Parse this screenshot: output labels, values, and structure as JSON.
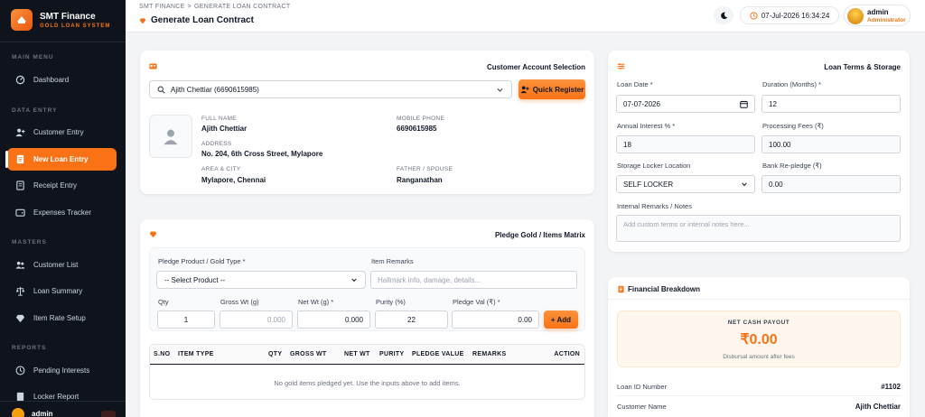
{
  "brand": {
    "title": "SMT Finance",
    "subtitle": "GOLD LOAN SYSTEM"
  },
  "sidebar": {
    "sections": [
      "MAIN MENU",
      "DATA ENTRY",
      "MASTERS",
      "REPORTS"
    ],
    "items": [
      {
        "label": "Dashboard",
        "icon": "dashboard-icon"
      },
      {
        "label": "Customer Entry",
        "icon": "user-plus-icon"
      },
      {
        "label": "New Loan Entry",
        "icon": "document-icon"
      },
      {
        "label": "Receipt Entry",
        "icon": "receipt-icon"
      },
      {
        "label": "Expenses Tracker",
        "icon": "wallet-icon"
      },
      {
        "label": "Customer List",
        "icon": "users-icon"
      },
      {
        "label": "Loan Summary",
        "icon": "scale-icon"
      },
      {
        "label": "Item Rate Setup",
        "icon": "gem-icon"
      },
      {
        "label": "Pending Interests",
        "icon": "clock-icon"
      },
      {
        "label": "Locker Report",
        "icon": "report-icon"
      }
    ],
    "user": "admin"
  },
  "header": {
    "breadcrumb": [
      "SMT FINANCE",
      "GENERATE LOAN CONTRACT"
    ],
    "title": "Generate Loan Contract",
    "datetime": "07-Jul-2026 16:34:24",
    "user_name": "admin",
    "user_role": "Administrator"
  },
  "customer": {
    "heading": "Customer Account Selection",
    "selected": "Ajith Chettiar (6690615985)",
    "quick_register": "Quick Register",
    "full_name_label": "FULL NAME",
    "full_name": "Ajith Chettiar",
    "mobile_label": "MOBILE PHONE",
    "mobile": "6690615985",
    "address_label": "ADDRESS",
    "address": "No. 204, 6th Cross Street, Mylapore",
    "area_label": "AREA & CITY",
    "area": "Mylapore, Chennai",
    "father_label": "FATHER / SPOUSE",
    "father": "Ranganathan"
  },
  "pledge": {
    "heading": "Pledge Gold / Items Matrix",
    "product_label": "Pledge Product / Gold Type *",
    "product_value": "-- Select Product --",
    "remarks_label": "Item Remarks",
    "remarks_placeholder": "Hallmark info, damage, details...",
    "qty_label": "Qty",
    "gross_label": "Gross Wt (g)",
    "net_label": "Net Wt (g) *",
    "purity_label": "Purity (%)",
    "val_label": "Pledge Val (₹) *",
    "qty": "1",
    "gross_placeholder": "0.000",
    "net": "0.000",
    "purity": "22",
    "val": "0.00",
    "add": "+ Add",
    "columns": [
      "S.NO",
      "ITEM TYPE",
      "QTY",
      "GROSS WT",
      "NET WT",
      "PURITY",
      "PLEDGE VALUE",
      "REMARKS",
      "ACTION"
    ],
    "empty_text": "No gold items pledged yet. Use the inputs above to add items."
  },
  "terms": {
    "heading": "Loan Terms & Storage",
    "loan_date_label": "Loan Date *",
    "loan_date": "07-07-2026",
    "duration_label": "Duration (Months) *",
    "duration": "12",
    "interest_label": "Annual Interest % *",
    "interest": "18",
    "fees_label": "Processing Fees (₹)",
    "fees": "100.00",
    "locker_label": "Storage Locker Location",
    "locker": "SELF LOCKER",
    "repledge_label": "Bank Re-pledge (₹)",
    "repledge": "0.00",
    "notes_label": "Internal Remarks / Notes",
    "notes_placeholder": "Add custom terms or internal notes here..."
  },
  "financial": {
    "heading": "Financial Breakdown",
    "payout_label": "NET CASH PAYOUT",
    "payout": "₹0.00",
    "payout_sub": "Disbursal amount after fees",
    "rows": [
      {
        "label": "Loan ID Number",
        "value": "#1102"
      },
      {
        "label": "Customer Name",
        "value": "Ajith Chettiar"
      }
    ]
  },
  "colors": {
    "accent": "#f97316",
    "sidebar": "#0f141c"
  }
}
